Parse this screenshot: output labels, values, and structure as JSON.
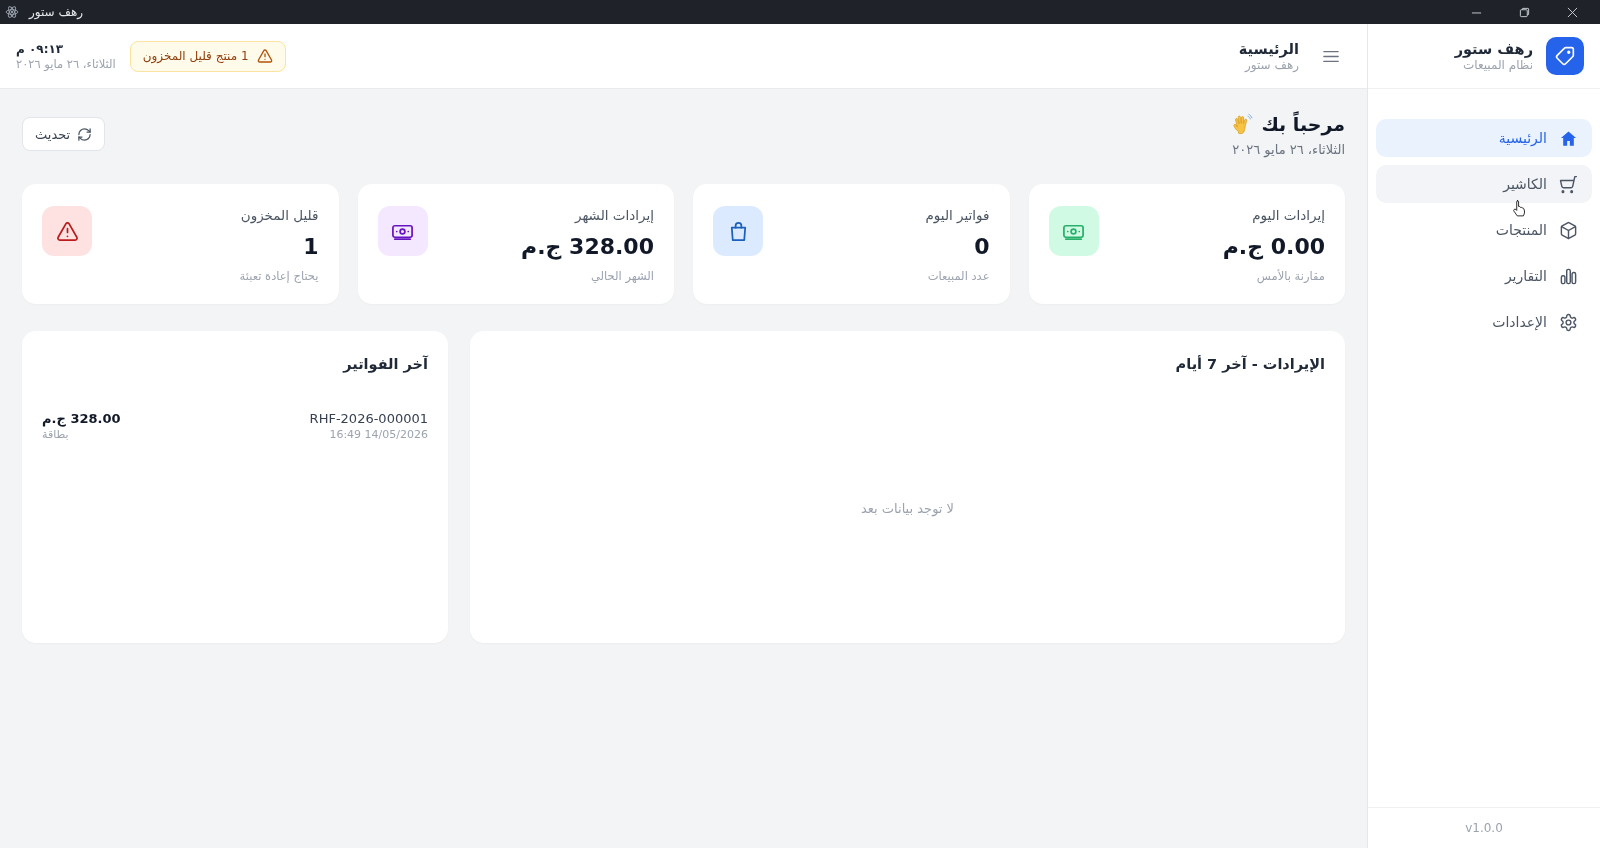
{
  "window": {
    "title": "رهف ستور"
  },
  "sidebar": {
    "brand": {
      "name": "رهف ستور",
      "subtitle": "نظام المبيعات"
    },
    "items": [
      {
        "label": "الرئيسية",
        "selected": true,
        "hovered": false
      },
      {
        "label": "الكاشير",
        "selected": false,
        "hovered": true
      },
      {
        "label": "المنتجات",
        "selected": false,
        "hovered": false
      },
      {
        "label": "التقارير",
        "selected": false,
        "hovered": false
      },
      {
        "label": "الإعدادات",
        "selected": false,
        "hovered": false
      }
    ],
    "version": "v1.0.0"
  },
  "header": {
    "title": "الرئيسية",
    "subtitle": "رهف ستور",
    "alert": "1 منتج قليل المخزون",
    "time": "٠٩:١٣ م",
    "date": "الثلاثاء، ٢٦ مايو ٢٠٢٦"
  },
  "welcome": {
    "title": "مرحباً بك",
    "date": "الثلاثاء، ٢٦ مايو ٢٠٢٦",
    "refresh_button": "تحديث"
  },
  "stats": [
    {
      "title": "إيرادات اليوم",
      "value": "0.00 ج.م",
      "caption": "مقارنة بالأمس",
      "color": "#d1fae5"
    },
    {
      "title": "فواتير اليوم",
      "value": "0",
      "caption": "عدد المبيعات",
      "color": "#dbeafe"
    },
    {
      "title": "إيرادات الشهر",
      "value": "328.00 ج.م",
      "caption": "الشهر الحالي",
      "color": "#f3e8ff"
    },
    {
      "title": "قليل المخزون",
      "value": "1",
      "caption": "يحتاج إعادة تعبئة",
      "color": "#fee2e2"
    }
  ],
  "revenue_chart": {
    "title": "الإيرادات - آخر 7 أيام",
    "empty_message": "لا توجد بيانات بعد"
  },
  "recent_invoices": {
    "title": "آخر الفواتير",
    "items": [
      {
        "number": "RHF-2026-000001",
        "date": "16:49 14/05/2026",
        "amount": "328.00 ج.م",
        "payment": "بطاقة"
      }
    ]
  }
}
